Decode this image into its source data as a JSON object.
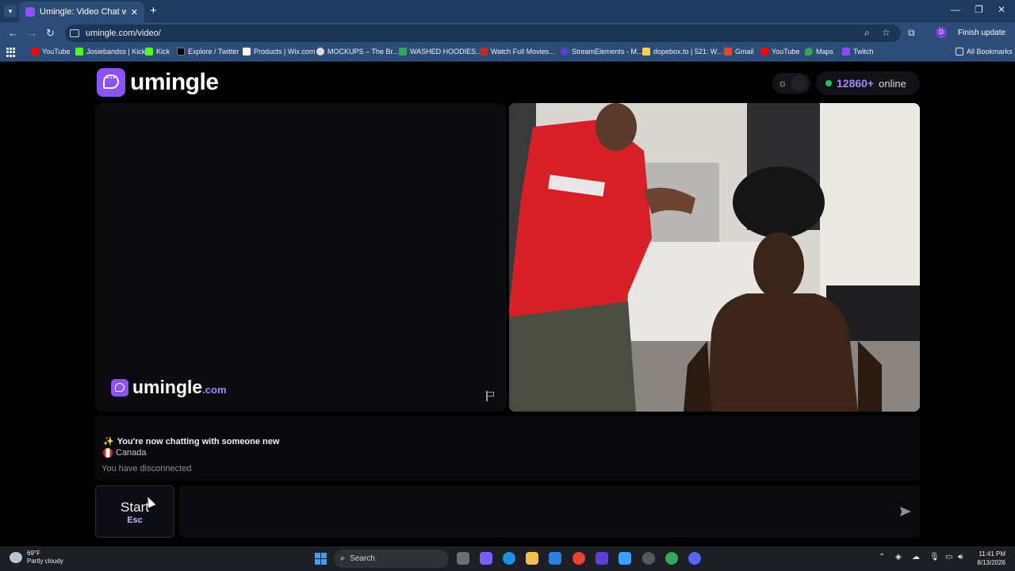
{
  "browser": {
    "tab_title": "Umingle: Video Chat with Strangers",
    "url": "umingle.com/video/",
    "finish_update": "Finish update",
    "profile_initial": "D",
    "bookmarks": [
      {
        "label": "YouTube",
        "color": "#ff0000"
      },
      {
        "label": "Josiebandss | Kick",
        "color": "#53fc18"
      },
      {
        "label": "Kick",
        "color": "#53fc18"
      },
      {
        "label": "Explore / Twitter",
        "color": "#000000"
      },
      {
        "label": "Products | Wix.com",
        "color": "#ffffff"
      },
      {
        "label": "MOCKUPS – The Br...",
        "color": "#dddddd"
      },
      {
        "label": "WASHED HOODIES...",
        "color": "#34a853"
      },
      {
        "label": "Watch Full Movies...",
        "color": "#c62828"
      },
      {
        "label": "StreamElements - M...",
        "color": "#5b3fd6"
      },
      {
        "label": "dopebox.to | 521: W...",
        "color": "#f7d046"
      },
      {
        "label": "Gmail",
        "color": "#ea4335"
      },
      {
        "label": "YouTube",
        "color": "#ff0000"
      },
      {
        "label": "Maps",
        "color": "#34a853"
      },
      {
        "label": "Twitch",
        "color": "#9146ff"
      }
    ],
    "all_bookmarks": "All Bookmarks"
  },
  "site": {
    "logo_text": "umingle",
    "watermark_text": "umingle",
    "watermark_domain": ".com",
    "online_count": "12860+",
    "online_label": "online",
    "accent_color": "#8c52ff"
  },
  "chat": {
    "now_chatting": "You're now chatting with someone new",
    "country": "Canada",
    "disconnected": "You have disconnected",
    "start_label": "Start",
    "start_key": "Esc",
    "input_value": ""
  },
  "taskbar": {
    "temperature": "69°F",
    "weather": "Partly cloudy",
    "search_label": "Search",
    "time": "11:41 PM",
    "date": "8/13/2026"
  }
}
